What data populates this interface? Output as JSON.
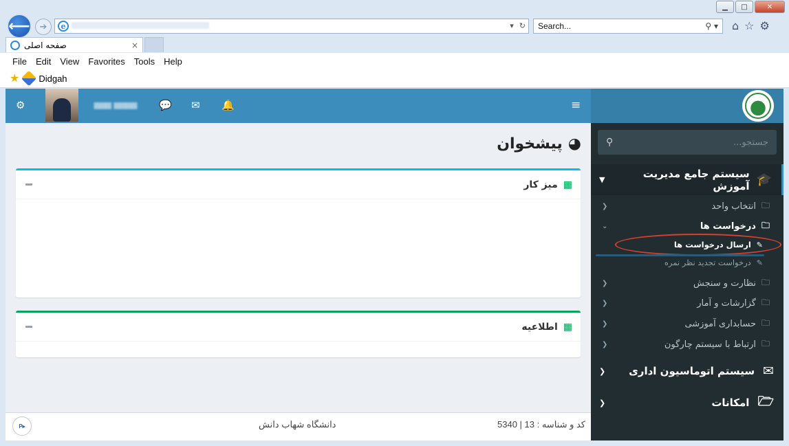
{
  "browser": {
    "search_placeholder": "Search...",
    "tab_title": "صفحه اصلی",
    "tab_close": "×",
    "back_glyph": "⟵",
    "forward_glyph": "➔",
    "menu": [
      "File",
      "Edit",
      "View",
      "Favorites",
      "Tools",
      "Help"
    ],
    "favorites": [
      {
        "label": "Didgah",
        "icon": "didgah-icon"
      }
    ],
    "window_controls": [
      "minimize",
      "maximize",
      "close"
    ]
  },
  "topbar": {
    "icons": [
      "cogs-icon",
      "wechat-icon",
      "envelope-icon",
      "bell-icon",
      "hamburger-icon"
    ],
    "colors": {
      "primary": "#3c8dbc",
      "logo_bg": "#367fa9"
    }
  },
  "sidebar": {
    "search_placeholder": "جستجو...",
    "system_title": "سیستم جامع مدیریت آموزش",
    "items": [
      {
        "label": "انتخاب واحد",
        "expanded": false
      },
      {
        "label": "درخواست ها",
        "expanded": true
      },
      {
        "label": "نظارت و سنجش",
        "expanded": false
      },
      {
        "label": "گزارشات و آمار",
        "expanded": false
      },
      {
        "label": "حسابداری آموزشی",
        "expanded": false
      },
      {
        "label": "ارتباط با سیستم چارگون",
        "expanded": false
      }
    ],
    "subitems": [
      {
        "label": "ارسال درخواست ها",
        "active": true
      },
      {
        "label": "درخواست تجدید نظر نمره",
        "active": false
      }
    ],
    "other_systems": [
      {
        "label": "سیستم اتوماسیون اداری",
        "icon": "envelope-icon"
      },
      {
        "label": "امکانات",
        "icon": "folder-open-icon"
      }
    ],
    "colors": {
      "bg": "#222d32",
      "highlight_oval": "#d9402b"
    }
  },
  "content": {
    "page_title": "پیشخوان",
    "boxes": [
      {
        "title": "میز کار",
        "border_color": "#00c0ef"
      },
      {
        "title": "اطلاعیه",
        "border_color": "#00a65a"
      }
    ]
  },
  "footer": {
    "code_text": "کد و شناسه : 13 | 5340",
    "university": "دانشگاه شهاب دانش",
    "brand_logo": "PARFCO"
  }
}
